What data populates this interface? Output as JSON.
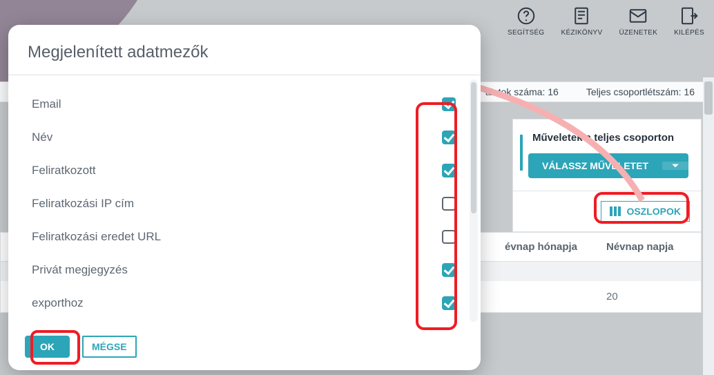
{
  "topnav": {
    "help": "SEGÍTSÉG",
    "manual": "KÉZIKÖNYV",
    "messages": "ÜZENETEK",
    "logout": "KILÉPÉS"
  },
  "counts": {
    "hits_label": "alatok száma:",
    "hits_value": "16",
    "group_label": "Teljes csoportlétszám:",
    "group_value": "16"
  },
  "actions": {
    "title": "Műveletek a teljes csoporton",
    "select": "VÁLASSZ MŰVELETET"
  },
  "columns_button": "OSZLOPOK",
  "grid": {
    "headers": {
      "col1": "évnap hónapja",
      "col2": "Névnap napja"
    },
    "rows": [
      {
        "col1": "",
        "col2": ""
      },
      {
        "col1": "",
        "col2": "20"
      }
    ]
  },
  "modal": {
    "title": "Megjelenített adatmezők",
    "fields": [
      {
        "label": "Email",
        "checked": true
      },
      {
        "label": "Név",
        "checked": true
      },
      {
        "label": "Feliratkozott",
        "checked": true
      },
      {
        "label": "Feliratkozási IP cím",
        "checked": false
      },
      {
        "label": "Feliratkozási eredet URL",
        "checked": false
      },
      {
        "label": "Privát megjegyzés",
        "checked": true
      },
      {
        "label": "exporthoz",
        "checked": true
      }
    ],
    "ok": "OK",
    "cancel": "MÉGSE"
  }
}
